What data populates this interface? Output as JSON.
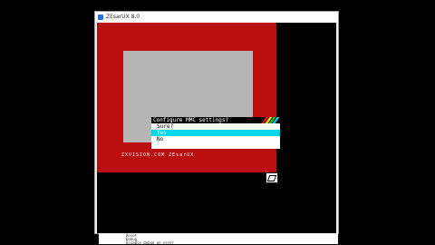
{
  "window": {
    "title": "ZEsarUX 8.0"
  },
  "screen": {
    "bottom_text": "ZXVISION.COM ZEsarUX"
  },
  "menu": {
    "title": "Configure MMC settings?",
    "items": [
      {
        "label": "Sure?",
        "selected": false
      },
      {
        "label": "Yes",
        "selected": true
      },
      {
        "label": "No",
        "selected": false
      }
    ]
  },
  "status_lines": [
    "Reset",
    "Debug",
    "Disable debug on error"
  ],
  "colors": {
    "border": "#bb0e0e",
    "paper": "#b6b6b6",
    "highlight": "#00d8ea",
    "rainbow": [
      "#e81a1a",
      "#f6d80e",
      "#2fb52f",
      "#10c8e8"
    ]
  }
}
